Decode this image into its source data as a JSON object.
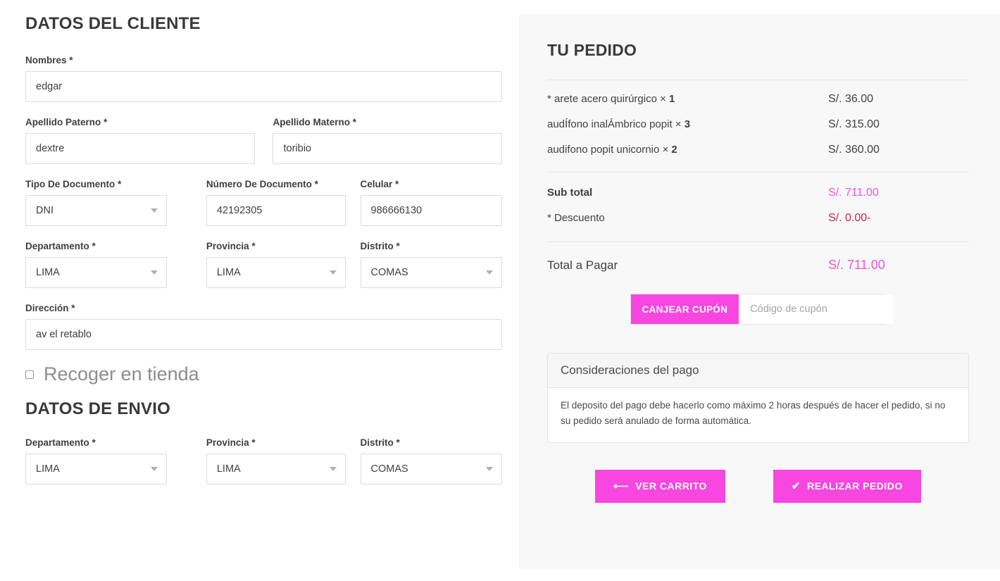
{
  "customer": {
    "heading": "DATOS DEL CLIENTE",
    "fields": {
      "nombres": {
        "label": "Nombres *",
        "value": "edgar"
      },
      "apellido_paterno": {
        "label": "Apellido Paterno *",
        "value": "dextre"
      },
      "apellido_materno": {
        "label": "Apellido Materno *",
        "value": "toribio"
      },
      "tipo_documento": {
        "label": "Tipo De Documento *",
        "value": "DNI"
      },
      "numero_documento": {
        "label": "Número De Documento *",
        "value": "42192305"
      },
      "celular": {
        "label": "Celular *",
        "value": "986666130"
      },
      "departamento": {
        "label": "Departamento *",
        "value": "LIMA"
      },
      "provincia": {
        "label": "Provincia *",
        "value": "LIMA"
      },
      "distrito": {
        "label": "Distrito *",
        "value": "COMAS"
      },
      "direccion": {
        "label": "Dirección *",
        "value": "av el retablo"
      }
    },
    "pickup_checkbox_label": "Recoger en tienda"
  },
  "shipping": {
    "heading": "DATOS DE ENVIO",
    "fields": {
      "departamento": {
        "label": "Departamento *",
        "value": "LIMA"
      },
      "provincia": {
        "label": "Provincia *",
        "value": "LIMA"
      },
      "distrito": {
        "label": "Distrito *",
        "value": "COMAS"
      }
    }
  },
  "order": {
    "title": "TU PEDIDO",
    "items": [
      {
        "name": "* arete acero quirúrgico ×",
        "qty": "1",
        "price": "S/. 36.00"
      },
      {
        "name": "audÍfono inalÁmbrico popit ×",
        "qty": "3",
        "price": "S/. 315.00"
      },
      {
        "name": "audifono popit unicornio ×",
        "qty": "2",
        "price": "S/. 360.00"
      }
    ],
    "subtotal": {
      "label": "Sub total",
      "value": "S/. 711.00"
    },
    "discount": {
      "label": "* Descuento",
      "value": "S/. 0.00-"
    },
    "grand_total": {
      "label": "Total a Pagar",
      "value": "S/. 711.00"
    },
    "coupon": {
      "button_label": "CANJEAR CUPÓN",
      "placeholder": "Código de cupón",
      "value": ""
    },
    "considerations": {
      "title": "Consideraciones del pago",
      "text": "El deposito del pago debe hacerlo como máximo 2 horas después de hacer el pedido, si no su pedido será anulado de forma automática."
    },
    "actions": {
      "back_to_cart": "VER CARRITO",
      "place_order": "REALIZAR PEDIDO"
    }
  },
  "colors": {
    "accent_pink": "#f846e0",
    "price_pink": "#f64ee0",
    "discount_red": "#cc1f3d",
    "panel_bg": "#f8f8f8"
  }
}
